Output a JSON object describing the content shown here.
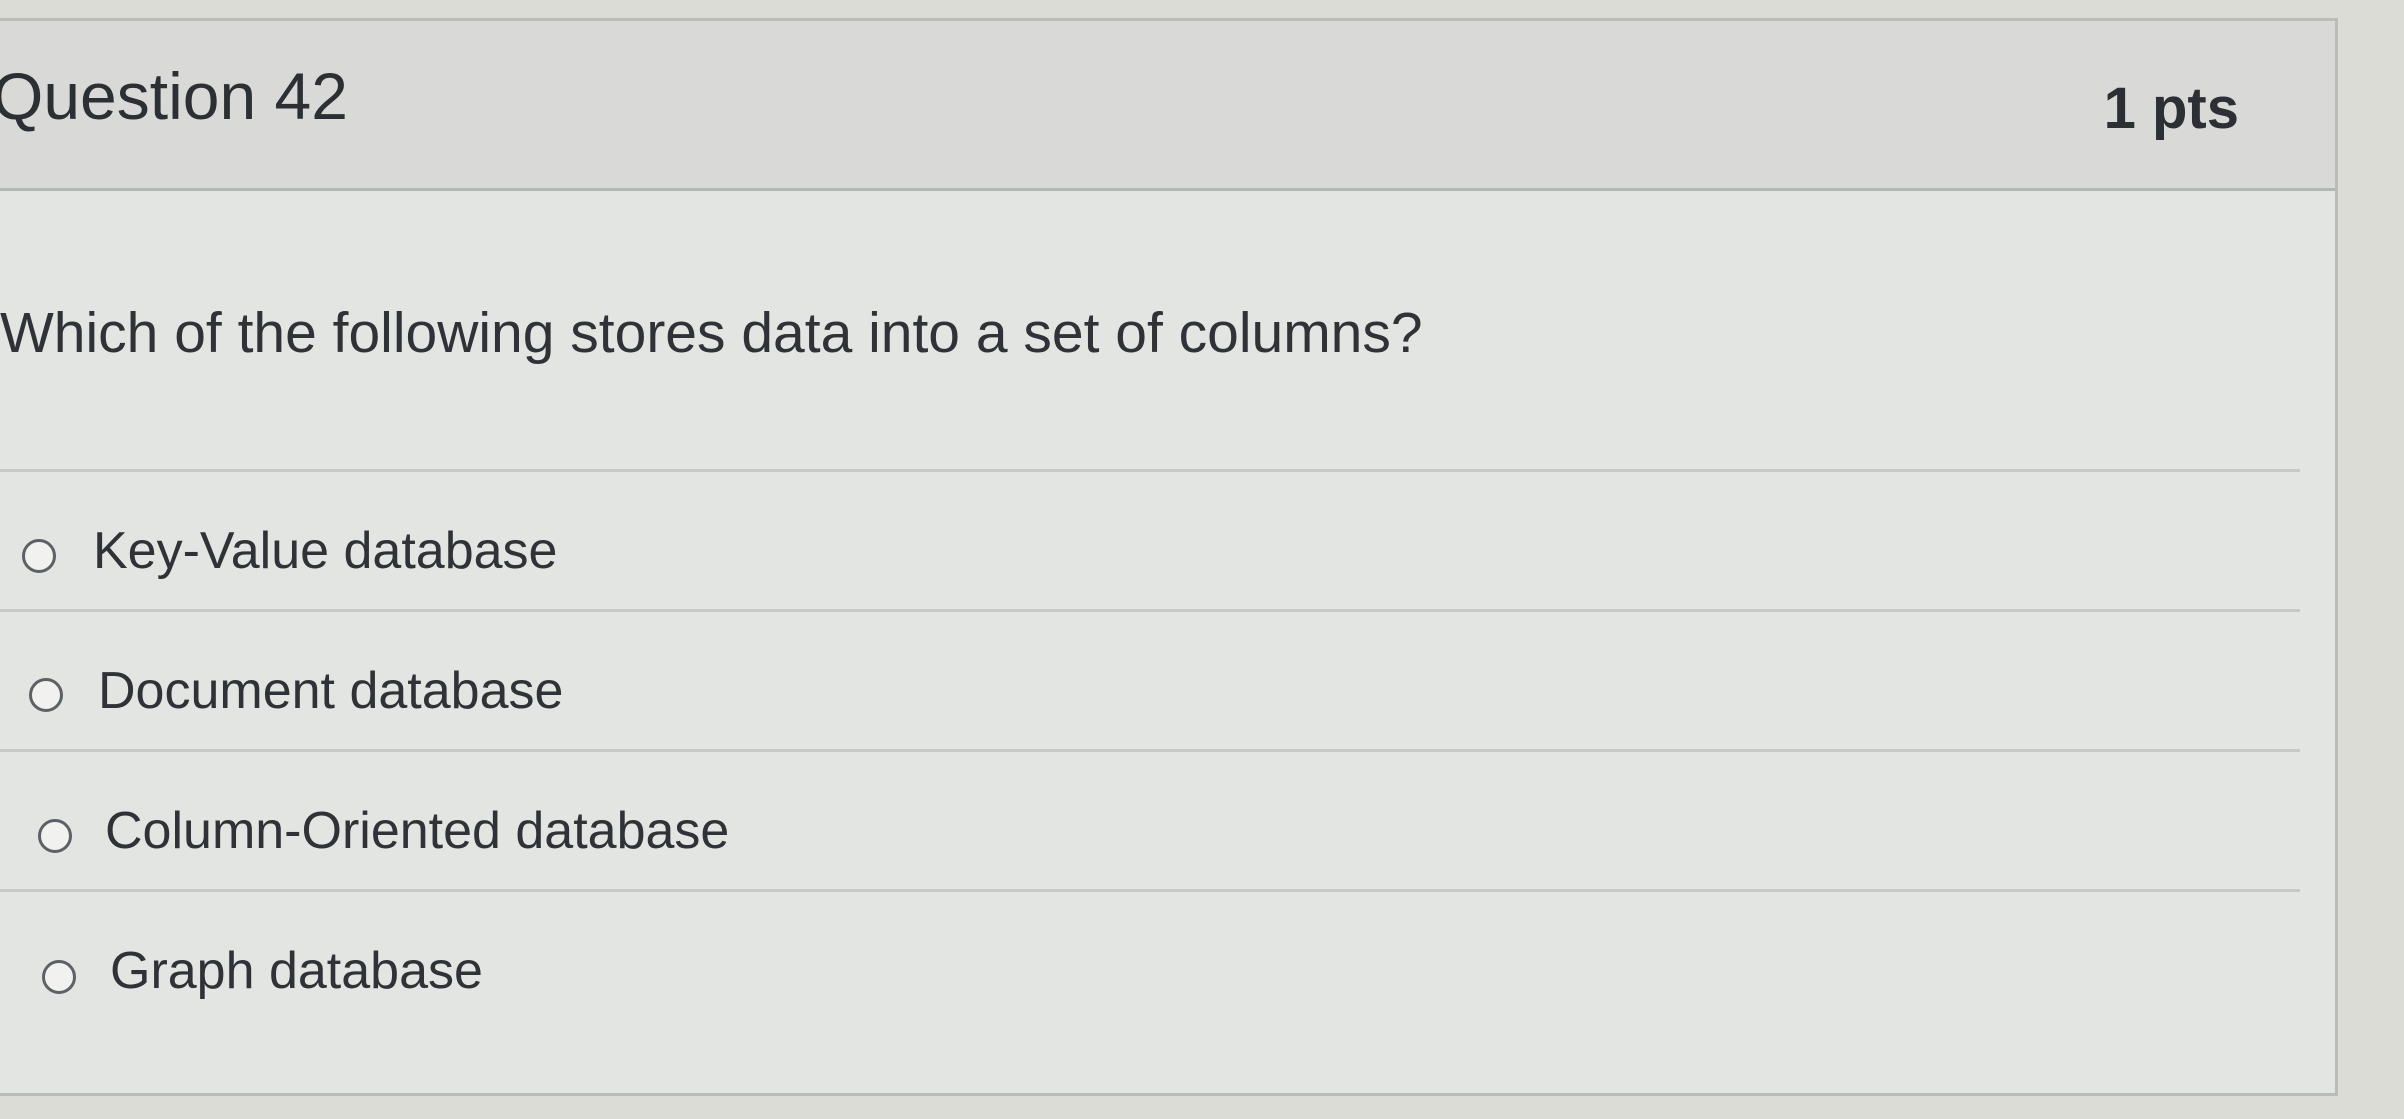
{
  "question": {
    "title": "Question 42",
    "points": "1 pts",
    "text": "Which of the following stores data into a set of columns?"
  },
  "answers": [
    {
      "label": "Key-Value database",
      "selected": false
    },
    {
      "label": "Document database",
      "selected": false
    },
    {
      "label": "Column-Oriented database",
      "selected": false
    },
    {
      "label": "Graph database",
      "selected": false
    }
  ]
}
